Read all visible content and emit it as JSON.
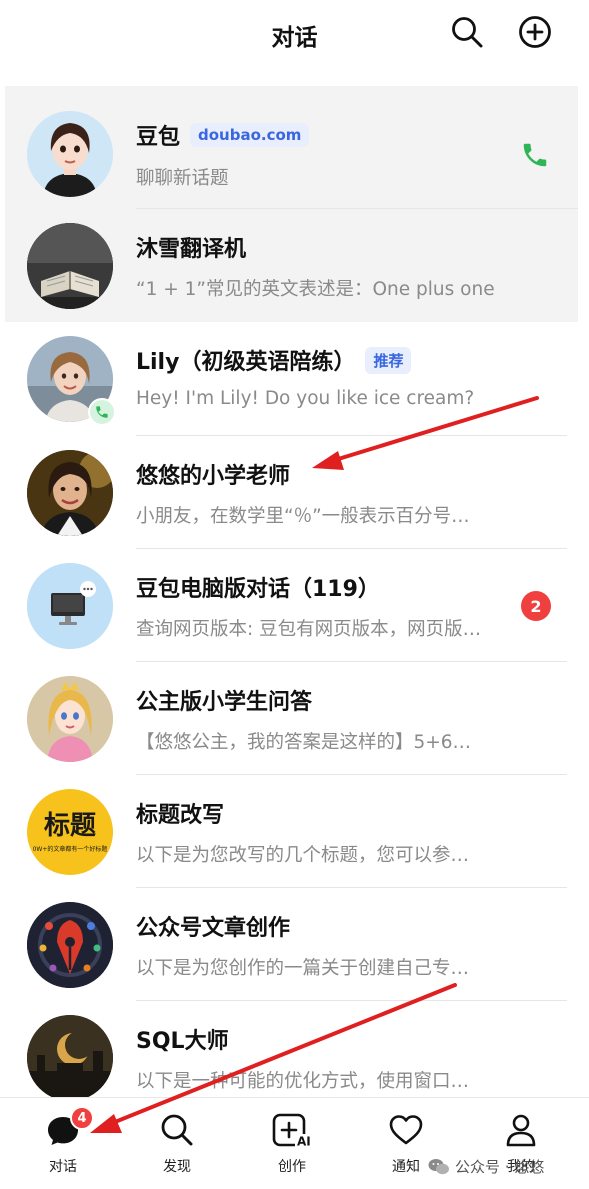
{
  "header": {
    "title": "对话",
    "search_icon": "search-icon",
    "add_icon": "plus-circle-icon"
  },
  "conversations": [
    {
      "name": "豆包",
      "tag": "doubao.com",
      "preview": "聊聊新话题",
      "pinned": true,
      "has_call": true
    },
    {
      "name": "沐雪翻译机",
      "preview": "“1 + 1”常见的英文表述是：One plus one",
      "pinned": true
    },
    {
      "name": "Lily（初级英语陪练）",
      "tag": "推荐",
      "preview": "Hey! I'm Lily! Do you like ice cream?"
    },
    {
      "name": "悠悠的小学老师",
      "preview": "小朋友，在数学里“％”一般表示百分号…"
    },
    {
      "name": "豆包电脑版对话（119）",
      "preview": "查询网页版本: 豆包有网页版本，网页版…",
      "unread": "2"
    },
    {
      "name": "公主版小学生问答",
      "preview": "【悠悠公主，我的答案是这样的】5+6…"
    },
    {
      "name": "标题改写",
      "preview": "以下是为您改写的几个标题，您可以参…",
      "avatar_text": "标题",
      "avatar_subtext": "0W+的文章都有一个好标题"
    },
    {
      "name": "公众号文章创作",
      "preview": "以下是为您创作的一篇关于创建自己专…"
    },
    {
      "name": "SQL大师",
      "preview": "以下是一种可能的优化方式，使用窗口…"
    }
  ],
  "tabbar": [
    {
      "label": "对话",
      "icon": "chat-bubble-icon",
      "badge": "4",
      "active": true
    },
    {
      "label": "发现",
      "icon": "search-icon"
    },
    {
      "label": "创作",
      "icon": "ai-create-icon"
    },
    {
      "label": "通知",
      "icon": "heart-icon"
    },
    {
      "label": "我的",
      "icon": "user-icon"
    }
  ],
  "watermark": {
    "text": "公众号 · 悠悠",
    "icon": "wechat-icon"
  },
  "colors": {
    "accent_red": "#f03f3f",
    "call_green": "#2fb457",
    "tag_blue": "#3a66e0",
    "annotation_red": "#e02020"
  }
}
